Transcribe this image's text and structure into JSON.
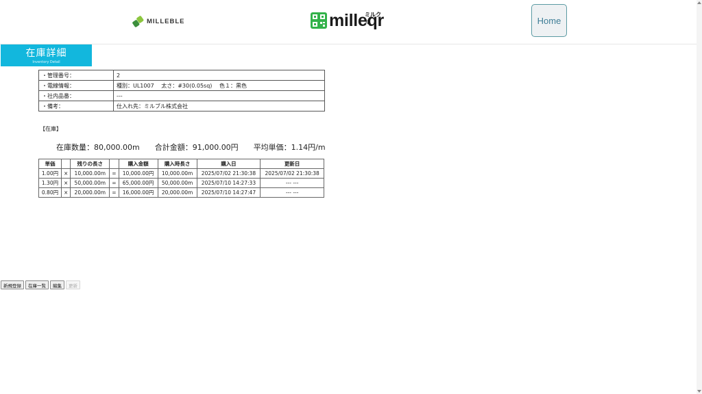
{
  "header": {
    "brand_left": "MILLEBLE",
    "brand_center": "milleqr",
    "brand_center_ruby": "ミルクル",
    "home_label": "Home"
  },
  "title": {
    "jp": "在庫詳細",
    "en": "Inventory Detail"
  },
  "info": [
    {
      "key": "・管理番号：",
      "value": "2"
    },
    {
      "key": "・電線情報：",
      "value": "種別：UL1007　 太さ：#30(0.05sq)　 色１：黒色"
    },
    {
      "key": "・社内品番：",
      "value": "---"
    },
    {
      "key": "・備考：",
      "value": "仕入れ先：ミルブル株式会社"
    }
  ],
  "section_label": "【在庫】",
  "summary": {
    "stock_qty": "在庫数量：80,000.00m",
    "total_amount": "合計金額：91,000.00円",
    "avg_price": "平均単価：1.14円/m"
  },
  "stock_table": {
    "headers": [
      "単価",
      "",
      "残りの長さ",
      "",
      "購入金額",
      "購入時長さ",
      "購入日",
      "更新日"
    ],
    "rows": [
      [
        "1.00円",
        "×",
        "10,000.00m",
        "=",
        "10,000.00円",
        "10,000.00m",
        "2025/07/02 21:30:38",
        "2025/07/02 21:30:38"
      ],
      [
        "1.30円",
        "×",
        "50,000.00m",
        "=",
        "65,000.00円",
        "50,000.00m",
        "2025/07/10 14:27:33",
        "--- ---"
      ],
      [
        "0.80円",
        "×",
        "20,000.00m",
        "=",
        "16,000.00円",
        "20,000.00m",
        "2025/07/10 14:27:47",
        "--- ---"
      ]
    ]
  },
  "buttons": {
    "new": "新規登録",
    "list": "在庫一覧",
    "edit": "編集",
    "update": "更新"
  }
}
